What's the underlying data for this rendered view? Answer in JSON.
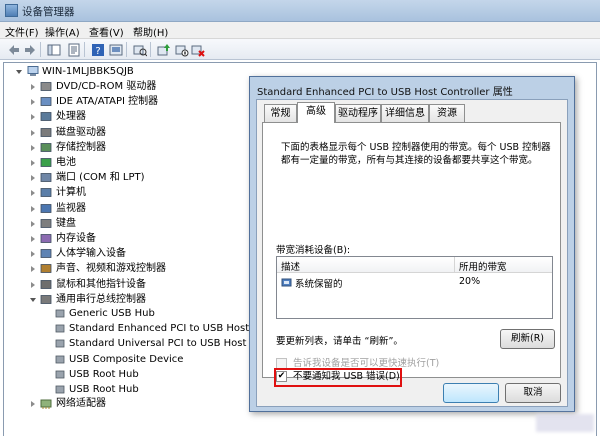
{
  "window": {
    "title": "设备管理器"
  },
  "menu": [
    "文件(F)",
    "操作(A)",
    "查看(V)",
    "帮助(H)"
  ],
  "toolbar_icons": [
    "back-icon",
    "forward-icon",
    "console-tree-icon",
    "properties-icon",
    "help-icon",
    "show-hidden-icon",
    "scan-hardware-icon",
    "update-driver-icon",
    "disable-device-icon",
    "uninstall-device-icon"
  ],
  "tree": {
    "root": "WIN-1MLJBBK5QJB",
    "categories": [
      {
        "label": "DVD/CD-ROM 驱动器",
        "icon": "dvd-drive-icon"
      },
      {
        "label": "IDE ATA/ATAPI 控制器",
        "icon": "ide-controller-icon"
      },
      {
        "label": "处理器",
        "icon": "processor-icon"
      },
      {
        "label": "磁盘驱动器",
        "icon": "disk-drive-icon"
      },
      {
        "label": "存储控制器",
        "icon": "storage-controller-icon"
      },
      {
        "label": "电池",
        "icon": "battery-icon"
      },
      {
        "label": "端口 (COM 和 LPT)",
        "icon": "port-icon"
      },
      {
        "label": "计算机",
        "icon": "computer-icon"
      },
      {
        "label": "监视器",
        "icon": "monitor-icon"
      },
      {
        "label": "键盘",
        "icon": "keyboard-icon"
      },
      {
        "label": "内存设备",
        "icon": "memory-device-icon"
      },
      {
        "label": "人体学输入设备",
        "icon": "hid-icon"
      },
      {
        "label": "声音、视频和游戏控制器",
        "icon": "sound-icon"
      },
      {
        "label": "鼠标和其他指针设备",
        "icon": "mouse-icon"
      },
      {
        "label": "通用串行总线控制器",
        "icon": "usb-controller-icon",
        "expanded": true
      }
    ],
    "usb_children": [
      "Generic USB Hub",
      "Standard Enhanced PCI to USB Host Cont",
      "Standard Universal PCI to USB Host Cont",
      "USB Composite Device",
      "USB Root Hub",
      "USB Root Hub"
    ],
    "after": {
      "label": "网络适配器",
      "icon": "network-adapter-icon"
    }
  },
  "dialog": {
    "title": "Standard Enhanced PCI to USB Host Controller 属性",
    "tabs": [
      "常规",
      "高级",
      "驱动程序",
      "详细信息",
      "资源"
    ],
    "active_tab": "高级",
    "description_line1": "下面的表格显示每个 USB 控制器使用的带宽。每个 USB 控制器",
    "description_line2": "都有一定量的带宽，所有与其连接的设备都要共享这个带宽。",
    "group_label": "带宽消耗设备(B):",
    "columns": [
      "描述",
      "所用的带宽"
    ],
    "rows": [
      {
        "desc": "系统保留的",
        "bandwidth": "20%"
      }
    ],
    "refresh_hint": "要更新列表，请单击 “刷新”。",
    "refresh_button": "刷新(R)",
    "option1": {
      "label": "告诉我设备是否可以更快速执行(T)",
      "checked": false,
      "enabled": false
    },
    "option2": {
      "label": "不要通知我 USB 错误(D)",
      "checked": true,
      "enabled": true
    },
    "ok_button": "",
    "cancel_button": "取消",
    "highlight_color": "#e01010"
  }
}
